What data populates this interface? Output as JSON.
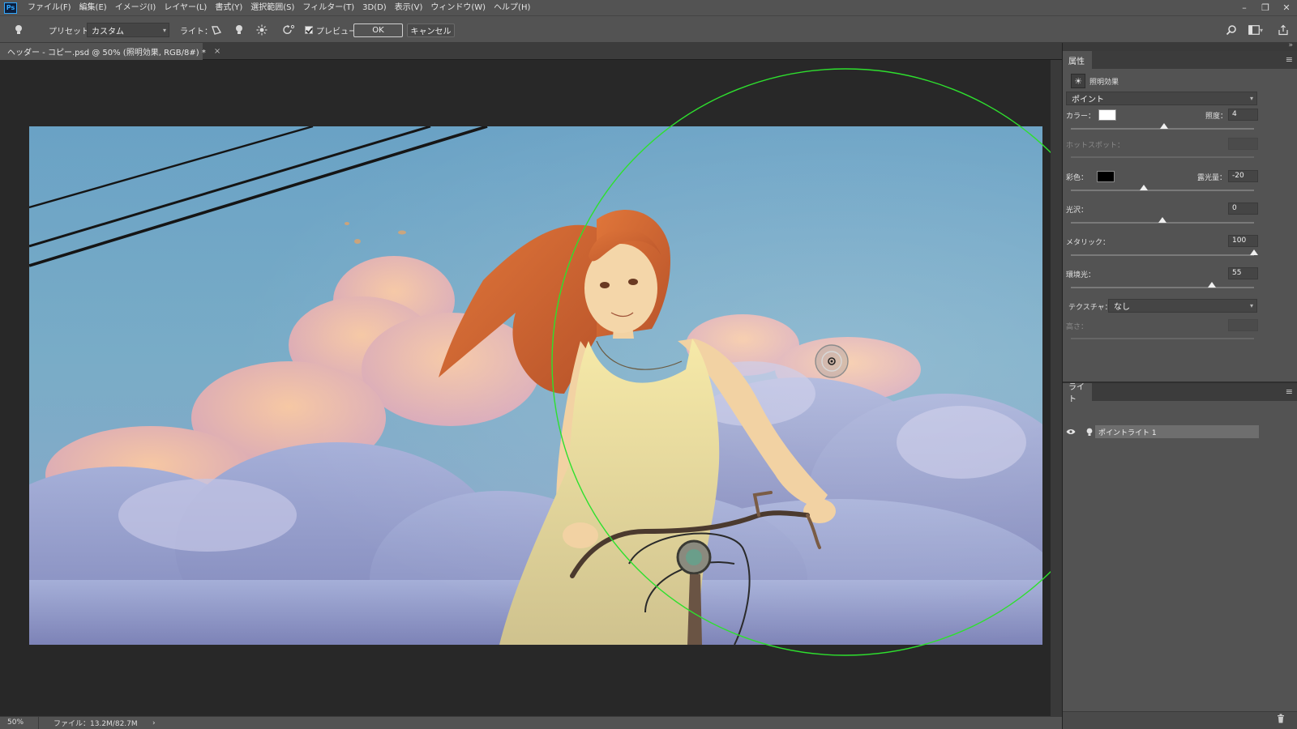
{
  "app": {
    "logo": "Ps"
  },
  "menu": [
    "ファイル(F)",
    "編集(E)",
    "イメージ(I)",
    "レイヤー(L)",
    "書式(Y)",
    "選択範囲(S)",
    "フィルター(T)",
    "3D(D)",
    "表示(V)",
    "ウィンドウ(W)",
    "ヘルプ(H)"
  ],
  "window_controls": {
    "minimize": "–",
    "restore": "❐",
    "close": "✕"
  },
  "options": {
    "preset_label": "プリセット：",
    "preset_value": "カスタム",
    "light_label": "ライト：",
    "preview_label": "プレビュー",
    "preview_checked": true,
    "ok_label": "OK",
    "cancel_label": "キャンセル"
  },
  "document": {
    "tab_title": "ヘッダー - コピー.psd @ 50% (照明効果, RGB/8#) *",
    "close_glyph": "×"
  },
  "status": {
    "zoom": "50%",
    "file_info": "ファイル：13.2M/82.7M",
    "arrow": "›"
  },
  "properties": {
    "tab_label": "属性",
    "effect_name": "照明効果",
    "light_type": "ポイント",
    "color_label": "カラー：",
    "color_value": "#ffffff",
    "intensity_label": "照度：",
    "intensity_value": "4",
    "intensity_fraction": 0.51,
    "hotspot_label": "ホットスポット：",
    "colorize_label": "彩色：",
    "colorize_value": "#000000",
    "exposure_label": "露光量：",
    "exposure_value": "-20",
    "exposure_fraction": 0.4,
    "gloss_label": "光沢：",
    "gloss_value": "0",
    "gloss_fraction": 0.5,
    "metallic_label": "メタリック：",
    "metallic_value": "100",
    "metallic_fraction": 1.0,
    "ambience_label": "環境光：",
    "ambience_value": "55",
    "ambience_fraction": 0.77,
    "texture_label": "テクスチャ：",
    "texture_value": "なし",
    "height_label": "高さ："
  },
  "lights": {
    "tab_label": "ライト",
    "items": [
      {
        "label": "ポイントライト 1"
      }
    ]
  },
  "icons": {
    "panel_menu": "≡",
    "eye": "👁",
    "bulb": "💡",
    "trash": "🗑"
  }
}
